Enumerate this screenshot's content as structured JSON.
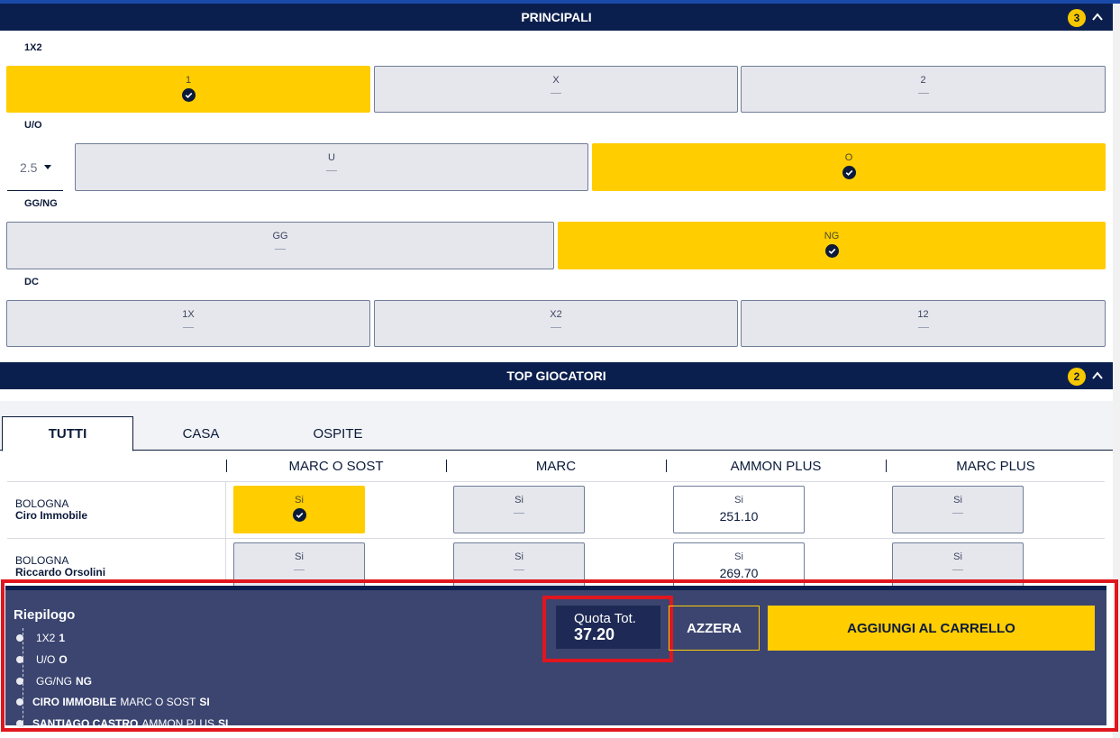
{
  "sections": {
    "principali": {
      "title": "PRINCIPALI",
      "count": "3"
    },
    "top_giocatori": {
      "title": "TOP GIOCATORI",
      "count": "2"
    }
  },
  "markets": {
    "m1x2": {
      "label": "1X2",
      "options": [
        {
          "label": "1",
          "selected": true
        },
        {
          "label": "X"
        },
        {
          "label": "2"
        }
      ]
    },
    "uo": {
      "label": "U/O",
      "line": "2.5",
      "options": [
        {
          "label": "U"
        },
        {
          "label": "O",
          "selected": true
        }
      ]
    },
    "ggng": {
      "label": "GG/NG",
      "options": [
        {
          "label": "GG"
        },
        {
          "label": "NG",
          "selected": true
        }
      ]
    },
    "dc": {
      "label": "DC",
      "options": [
        {
          "label": "1X"
        },
        {
          "label": "X2"
        },
        {
          "label": "12"
        }
      ]
    }
  },
  "tabs": [
    "TUTTI",
    "CASA",
    "OSPITE"
  ],
  "columns": [
    "MARC O SOST",
    "MARC",
    "AMMON PLUS",
    "MARC PLUS"
  ],
  "players": [
    {
      "team": "BOLOGNA",
      "name": "Ciro Immobile",
      "cells": [
        {
          "label": "Si",
          "selected": true
        },
        {
          "label": "Si"
        },
        {
          "label": "Si",
          "price": "251.10"
        },
        {
          "label": "Si"
        }
      ]
    },
    {
      "team": "BOLOGNA",
      "name": "Riccardo Orsolini",
      "cells": [
        {
          "label": "Si"
        },
        {
          "label": "Si"
        },
        {
          "label": "Si",
          "price": "269.70"
        },
        {
          "label": "Si"
        }
      ]
    }
  ],
  "summary": {
    "title": "Riepilogo",
    "items": [
      {
        "market": "1X2",
        "value": "1"
      },
      {
        "market": "U/O",
        "value": "O"
      },
      {
        "market": "GG/NG",
        "value": "NG"
      },
      {
        "player": "CIRO IMMOBILE",
        "market": "MARC O SOST",
        "value": "SI"
      },
      {
        "player": "SANTIAGO CASTRO",
        "market": "AMMON PLUS",
        "value": "SI"
      }
    ],
    "quota_label": "Quota Tot.",
    "quota_value": "37.20",
    "reset_label": "AZZERA",
    "add_label": "AGGIUNGI AL CARRELLO"
  },
  "colors": {
    "navy": "#0b1f4f",
    "yellow": "#ffcd00",
    "summary_bg": "#3b4570",
    "highlight": "#e0161e"
  }
}
